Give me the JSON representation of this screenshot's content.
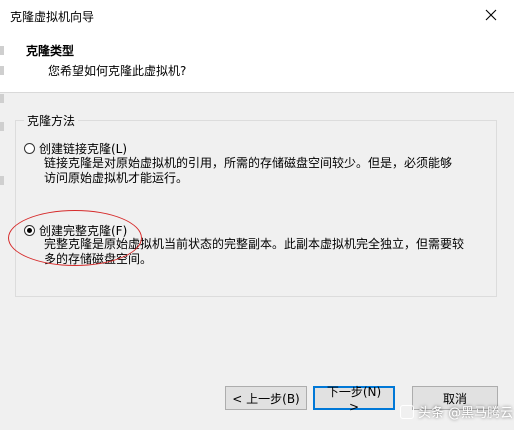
{
  "window": {
    "title": "克隆虚拟机向导"
  },
  "header": {
    "title": "克隆类型",
    "subtitle": "您希望如何克隆此虚拟机?"
  },
  "method_group": {
    "label": "克隆方法",
    "options": [
      {
        "label": "创建链接克隆(L)",
        "checked": false,
        "desc_line1": "链接克隆是对原始虚拟机的引用，所需的存储磁盘空间较少。但是，必须能够",
        "desc_line2": "访问原始虚拟机才能运行。"
      },
      {
        "label": "创建完整克隆(F)",
        "checked": true,
        "desc_line1": "完整克隆是原始虚拟机当前状态的完整副本。此副本虚拟机完全独立，但需要较",
        "desc_line2": "多的存储磁盘空间。"
      }
    ]
  },
  "buttons": {
    "back": "< 上一步(B)",
    "next": "下一步(N) >",
    "cancel": "取消"
  },
  "watermark": "头条 @黑马腾云",
  "colors": {
    "annotation": "#d62c2c",
    "primary_border": "#0078d7"
  }
}
